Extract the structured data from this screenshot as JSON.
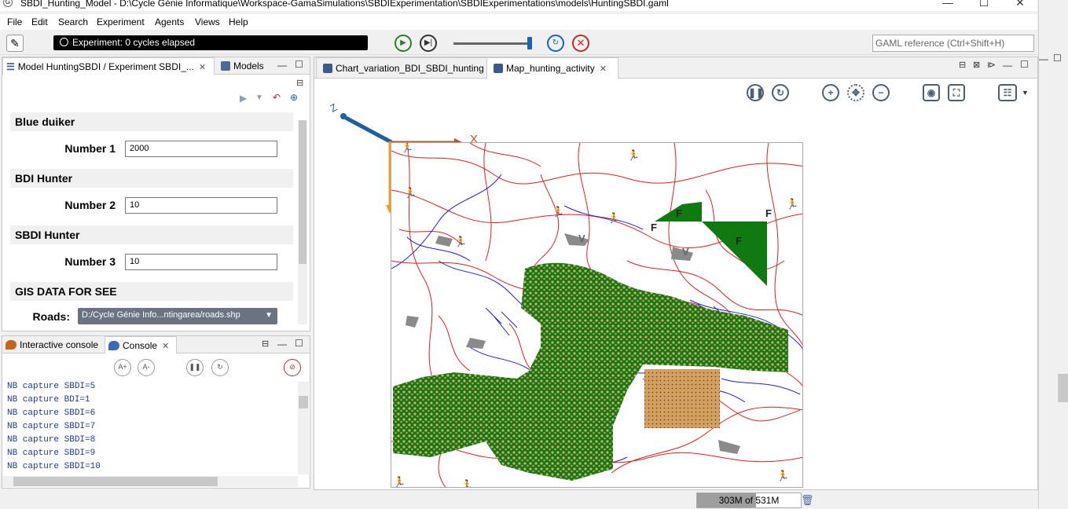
{
  "window": {
    "title": "SBDI_Hunting_Model - D:\\Cycle Génie Informatique\\Workspace-GamaSimulations\\SBDIExperimentation\\SBDIExperimentations\\models\\HuntingSBDI.gaml",
    "minimize": "—",
    "maximize": "☐",
    "close": "✕"
  },
  "menu": [
    "File",
    "Edit",
    "Search",
    "Experiment",
    "Agents",
    "Views",
    "Help"
  ],
  "toolbar": {
    "status": "Experiment: 0 cycles elapsed",
    "search_placeholder": "GAML reference (Ctrl+Shift+H)"
  },
  "params_panel": {
    "tab_label": "Model HuntingSBDI / Experiment SBDI_...",
    "models_tab": "Models",
    "sections": [
      {
        "header": "Blue duiker",
        "label": "Number 1",
        "value": "2000"
      },
      {
        "header": "BDI Hunter",
        "label": "Number 2",
        "value": "10"
      },
      {
        "header": "SBDI Hunter",
        "label": "Number 3",
        "value": "10"
      },
      {
        "header": "GIS DATA FOR SEE",
        "label": "Roads:",
        "value": "D:/Cycle Génie Info...ntingarea/roads.shp"
      }
    ]
  },
  "console_panel": {
    "interactive_tab": "Interactive console",
    "console_tab": "Console",
    "lines": [
      "NB capture SBDI=5",
      "NB capture BDI=1",
      "NB capture SBDI=6",
      "NB capture SBDI=7",
      "NB capture SBDI=8",
      "NB capture SBDI=9",
      "NB capture SBDI=10"
    ]
  },
  "editor": {
    "tabs": [
      "Chart_variation_BDI_SBDI_hunting",
      "Map_hunting_activity"
    ],
    "axis_labels": {
      "x": "X",
      "z": "Z"
    },
    "map_markers": [
      "F",
      "F",
      "F",
      "F",
      "V",
      "V"
    ]
  },
  "footer": {
    "memory": "303M of 531M",
    "memory_fraction": 0.57
  },
  "colors": {
    "roads": "#e02020",
    "rivers": "#2020d0",
    "forest": "#0f7a0f",
    "prey": "#d4a060",
    "x_axis": "#d04a1c",
    "y_axis": "#f0a020",
    "z_axis": "#1e5fa0"
  }
}
